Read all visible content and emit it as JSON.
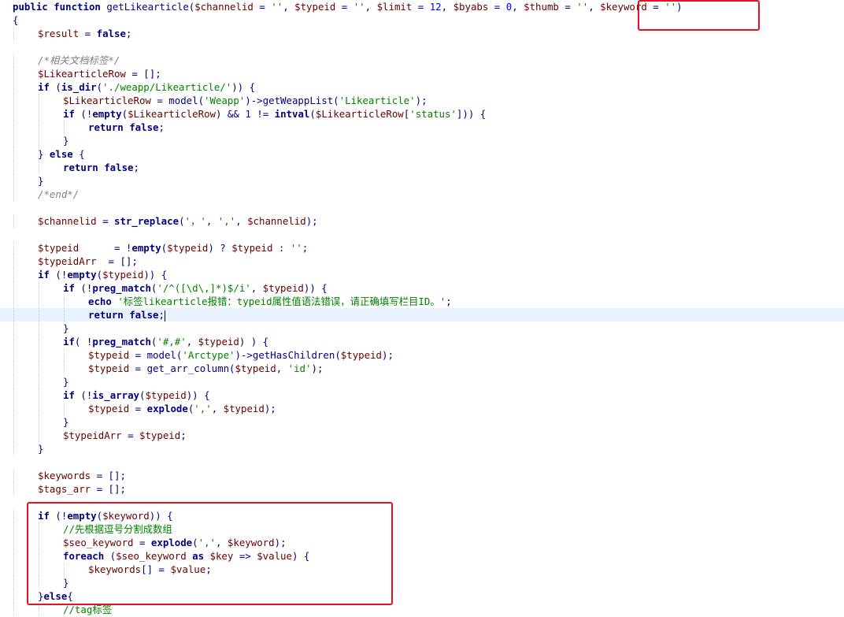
{
  "code_lines": [
    {
      "i": 0,
      "indent": 0,
      "t": [
        [
          "kw",
          "public function "
        ],
        [
          "",
          "getLikearticle("
        ],
        [
          "var",
          "$channelid"
        ],
        [
          "",
          " = "
        ],
        [
          "str",
          "''"
        ],
        [
          "",
          ", "
        ],
        [
          "var",
          "$typeid"
        ],
        [
          "",
          " = "
        ],
        [
          "str",
          "''"
        ],
        [
          "",
          ", "
        ],
        [
          "var",
          "$limit"
        ],
        [
          "",
          " = "
        ],
        [
          "num",
          "12"
        ],
        [
          "",
          ", "
        ],
        [
          "var",
          "$byabs"
        ],
        [
          "",
          " = "
        ],
        [
          "num",
          "0"
        ],
        [
          "",
          ", "
        ],
        [
          "var",
          "$thumb"
        ],
        [
          "",
          " = "
        ],
        [
          "str",
          "''"
        ],
        [
          "",
          ", "
        ],
        [
          "var",
          "$keyword"
        ],
        [
          "",
          " = "
        ],
        [
          "str",
          "''"
        ],
        [
          "",
          ")"
        ]
      ]
    },
    {
      "i": 1,
      "indent": 0,
      "t": [
        [
          "",
          "{"
        ]
      ]
    },
    {
      "i": 2,
      "indent": 1,
      "t": [
        [
          "var",
          "$result"
        ],
        [
          "",
          " = "
        ],
        [
          "kw",
          "false"
        ],
        [
          "",
          ";"
        ]
      ]
    },
    {
      "i": 4,
      "indent": 1,
      "t": [
        [
          "cmt",
          "/*"
        ],
        [
          "cmt cjk",
          "相关文档标签"
        ],
        [
          "cmt",
          "*/"
        ]
      ]
    },
    {
      "i": 5,
      "indent": 1,
      "t": [
        [
          "var",
          "$LikearticleRow"
        ],
        [
          "",
          " = [];"
        ]
      ]
    },
    {
      "i": 6,
      "indent": 1,
      "t": [
        [
          "kw",
          "if"
        ],
        [
          "",
          " ("
        ],
        [
          "kw",
          "is_dir"
        ],
        [
          "",
          "("
        ],
        [
          "str",
          "'./weapp/Likearticle/'"
        ],
        [
          "",
          ")) {"
        ]
      ]
    },
    {
      "i": 7,
      "indent": 2,
      "t": [
        [
          "var",
          "$LikearticleRow"
        ],
        [
          "",
          " = model("
        ],
        [
          "str",
          "'Weapp'"
        ],
        [
          "",
          ")->getWeappList("
        ],
        [
          "str",
          "'Likearticle'"
        ],
        [
          "",
          ");"
        ]
      ]
    },
    {
      "i": 8,
      "indent": 2,
      "t": [
        [
          "kw",
          "if"
        ],
        [
          "",
          " (!"
        ],
        [
          "kw",
          "empty"
        ],
        [
          "",
          "("
        ],
        [
          "var",
          "$LikearticleRow"
        ],
        [
          "",
          ") && "
        ],
        [
          "num",
          "1"
        ],
        [
          "",
          " != "
        ],
        [
          "kw",
          "intval"
        ],
        [
          "",
          "("
        ],
        [
          "var",
          "$LikearticleRow"
        ],
        [
          "",
          "["
        ],
        [
          "str",
          "'status'"
        ],
        [
          "",
          "])) {"
        ]
      ]
    },
    {
      "i": 9,
      "indent": 3,
      "t": [
        [
          "kw",
          "return false"
        ],
        [
          "",
          ";"
        ]
      ]
    },
    {
      "i": 10,
      "indent": 2,
      "t": [
        [
          "",
          "}"
        ]
      ]
    },
    {
      "i": 11,
      "indent": 1,
      "t": [
        [
          "",
          "} "
        ],
        [
          "kw",
          "else"
        ],
        [
          "",
          " {"
        ]
      ]
    },
    {
      "i": 12,
      "indent": 2,
      "t": [
        [
          "kw",
          "return false"
        ],
        [
          "",
          ";"
        ]
      ]
    },
    {
      "i": 13,
      "indent": 1,
      "t": [
        [
          "",
          "}"
        ]
      ]
    },
    {
      "i": 14,
      "indent": 1,
      "t": [
        [
          "cmt",
          "/*end*/"
        ]
      ]
    },
    {
      "i": 16,
      "indent": 1,
      "t": [
        [
          "var",
          "$channelid"
        ],
        [
          "",
          " = "
        ],
        [
          "kw",
          "str_replace"
        ],
        [
          "",
          "("
        ],
        [
          "str",
          "'"
        ],
        [
          "str cjk",
          "，"
        ],
        [
          "str",
          "'"
        ],
        [
          "",
          ", "
        ],
        [
          "str",
          "','"
        ],
        [
          "",
          ", "
        ],
        [
          "var",
          "$channelid"
        ],
        [
          "",
          ");"
        ]
      ]
    },
    {
      "i": 18,
      "indent": 1,
      "t": [
        [
          "var",
          "$typeid"
        ],
        [
          "",
          "      = !"
        ],
        [
          "kw",
          "empty"
        ],
        [
          "",
          "("
        ],
        [
          "var",
          "$typeid"
        ],
        [
          "",
          ") ? "
        ],
        [
          "var",
          "$typeid"
        ],
        [
          "",
          " : "
        ],
        [
          "str",
          "''"
        ],
        [
          "",
          ";"
        ]
      ]
    },
    {
      "i": 19,
      "indent": 1,
      "t": [
        [
          "var",
          "$typeidArr"
        ],
        [
          "",
          "  = [];"
        ]
      ]
    },
    {
      "i": 20,
      "indent": 1,
      "t": [
        [
          "kw",
          "if"
        ],
        [
          "",
          " (!"
        ],
        [
          "kw",
          "empty"
        ],
        [
          "",
          "("
        ],
        [
          "var",
          "$typeid"
        ],
        [
          "",
          ")) {"
        ]
      ]
    },
    {
      "i": 21,
      "indent": 2,
      "t": [
        [
          "kw",
          "if"
        ],
        [
          "",
          " (!"
        ],
        [
          "kw",
          "preg_match"
        ],
        [
          "",
          "("
        ],
        [
          "str",
          "'/^([\\d\\,]*)$/i'"
        ],
        [
          "",
          ", "
        ],
        [
          "var",
          "$typeid"
        ],
        [
          "",
          ")) {"
        ]
      ]
    },
    {
      "i": 22,
      "indent": 3,
      "t": [
        [
          "kw",
          "echo "
        ],
        [
          "str",
          "'"
        ],
        [
          "str cjk",
          "标签"
        ],
        [
          "str",
          "likearticle"
        ],
        [
          "str cjk",
          "报错："
        ],
        [
          "str",
          "typeid"
        ],
        [
          "str cjk",
          "属性值语法错误，请正确填写栏目"
        ],
        [
          "str",
          "ID"
        ],
        [
          "str cjk",
          "。"
        ],
        [
          "str",
          "'"
        ],
        [
          "",
          ";"
        ]
      ]
    },
    {
      "i": 23,
      "indent": 3,
      "current": true,
      "t": [
        [
          "kw",
          "return false"
        ],
        [
          "",
          ";"
        ]
      ]
    },
    {
      "i": 24,
      "indent": 2,
      "t": [
        [
          "",
          "}"
        ]
      ]
    },
    {
      "i": 25,
      "indent": 2,
      "t": [
        [
          "kw",
          "if"
        ],
        [
          "",
          "( !"
        ],
        [
          "kw",
          "preg_match"
        ],
        [
          "",
          "("
        ],
        [
          "str",
          "'#,#'"
        ],
        [
          "",
          ", "
        ],
        [
          "var",
          "$typeid"
        ],
        [
          "",
          ") ) {"
        ]
      ]
    },
    {
      "i": 26,
      "indent": 3,
      "t": [
        [
          "var",
          "$typeid"
        ],
        [
          "",
          " = model("
        ],
        [
          "str",
          "'Arctype'"
        ],
        [
          "",
          ")->getHasChildren("
        ],
        [
          "var",
          "$typeid"
        ],
        [
          "",
          ");"
        ]
      ]
    },
    {
      "i": 27,
      "indent": 3,
      "t": [
        [
          "var",
          "$typeid"
        ],
        [
          "",
          " = get_arr_column("
        ],
        [
          "var",
          "$typeid"
        ],
        [
          "",
          ", "
        ],
        [
          "str",
          "'id'"
        ],
        [
          "",
          ");"
        ]
      ]
    },
    {
      "i": 28,
      "indent": 2,
      "t": [
        [
          "",
          "}"
        ]
      ]
    },
    {
      "i": 29,
      "indent": 2,
      "t": [
        [
          "kw",
          "if"
        ],
        [
          "",
          " (!"
        ],
        [
          "kw",
          "is_array"
        ],
        [
          "",
          "("
        ],
        [
          "var",
          "$typeid"
        ],
        [
          "",
          ")) {"
        ]
      ]
    },
    {
      "i": 30,
      "indent": 3,
      "t": [
        [
          "var",
          "$typeid"
        ],
        [
          "",
          " = "
        ],
        [
          "kw",
          "explode"
        ],
        [
          "",
          "("
        ],
        [
          "str",
          "','"
        ],
        [
          "",
          ", "
        ],
        [
          "var",
          "$typeid"
        ],
        [
          "",
          ");"
        ]
      ]
    },
    {
      "i": 31,
      "indent": 2,
      "t": [
        [
          "",
          "}"
        ]
      ]
    },
    {
      "i": 32,
      "indent": 2,
      "t": [
        [
          "var",
          "$typeidArr"
        ],
        [
          "",
          " = "
        ],
        [
          "var",
          "$typeid"
        ],
        [
          "",
          ";"
        ]
      ]
    },
    {
      "i": 33,
      "indent": 1,
      "t": [
        [
          "",
          "}"
        ]
      ]
    },
    {
      "i": 35,
      "indent": 1,
      "t": [
        [
          "var",
          "$keywords"
        ],
        [
          "",
          " = [];"
        ]
      ]
    },
    {
      "i": 36,
      "indent": 1,
      "t": [
        [
          "var",
          "$tags_arr"
        ],
        [
          "",
          " = [];"
        ]
      ]
    },
    {
      "i": 38,
      "indent": 1,
      "t": [
        [
          "kw",
          "if"
        ],
        [
          "",
          " (!"
        ],
        [
          "kw",
          "empty"
        ],
        [
          "",
          "("
        ],
        [
          "var",
          "$keyword"
        ],
        [
          "",
          ")) {"
        ]
      ]
    },
    {
      "i": 39,
      "indent": 2,
      "t": [
        [
          "str",
          "//"
        ],
        [
          "str cjk",
          "先根据逗号分割成数组"
        ]
      ]
    },
    {
      "i": 40,
      "indent": 2,
      "t": [
        [
          "var",
          "$seo_keyword"
        ],
        [
          "",
          " = "
        ],
        [
          "kw",
          "explode"
        ],
        [
          "",
          "("
        ],
        [
          "str",
          "','"
        ],
        [
          "",
          ", "
        ],
        [
          "var",
          "$keyword"
        ],
        [
          "",
          ");"
        ]
      ]
    },
    {
      "i": 41,
      "indent": 2,
      "t": [
        [
          "kw",
          "foreach"
        ],
        [
          "",
          " ("
        ],
        [
          "var",
          "$seo_keyword"
        ],
        [
          "kw",
          " as "
        ],
        [
          "var",
          "$key"
        ],
        [
          "",
          " => "
        ],
        [
          "var",
          "$value"
        ],
        [
          "",
          ") {"
        ]
      ]
    },
    {
      "i": 42,
      "indent": 3,
      "t": [
        [
          "var",
          "$keywords"
        ],
        [
          "",
          "[] = "
        ],
        [
          "var",
          "$value"
        ],
        [
          "",
          ";"
        ]
      ]
    },
    {
      "i": 43,
      "indent": 2,
      "t": [
        [
          "",
          "}"
        ]
      ]
    },
    {
      "i": 44,
      "indent": 1,
      "t": [
        [
          "",
          "}"
        ],
        [
          "kw",
          "else"
        ],
        [
          "",
          "{"
        ]
      ]
    },
    {
      "i": 45,
      "indent": 2,
      "t": [
        [
          "str",
          "//tag"
        ],
        [
          "str cjk",
          "标签"
        ]
      ]
    }
  ]
}
